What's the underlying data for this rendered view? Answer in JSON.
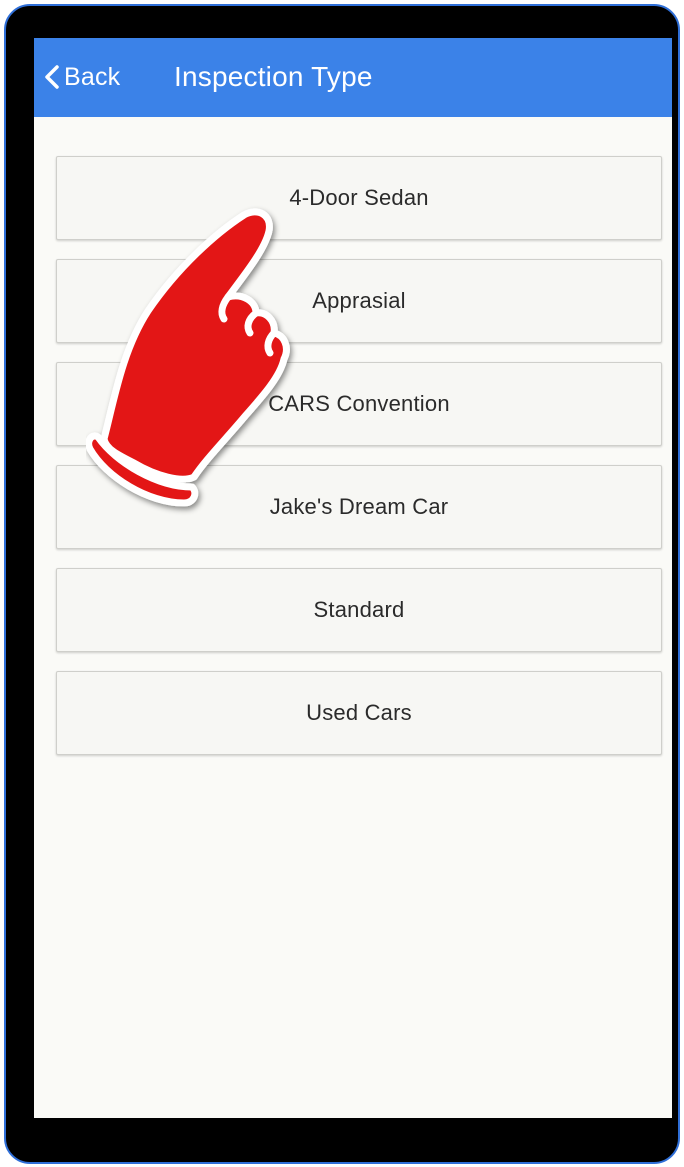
{
  "header": {
    "back_label": "Back",
    "title": "Inspection Type"
  },
  "inspection_types": [
    {
      "label": "4-Door Sedan"
    },
    {
      "label": "Apprasial"
    },
    {
      "label": "CARS Convention"
    },
    {
      "label": "Jake's Dream Car"
    },
    {
      "label": "Standard"
    },
    {
      "label": "Used Cars"
    }
  ],
  "icons": {
    "back": "chevron-left-icon",
    "pointer": "pointing-hand-icon"
  },
  "colors": {
    "appbar": "#3b82e8",
    "screen_background": "#fafaf7",
    "frame": "#000000",
    "pointer_fill": "#e31414"
  }
}
